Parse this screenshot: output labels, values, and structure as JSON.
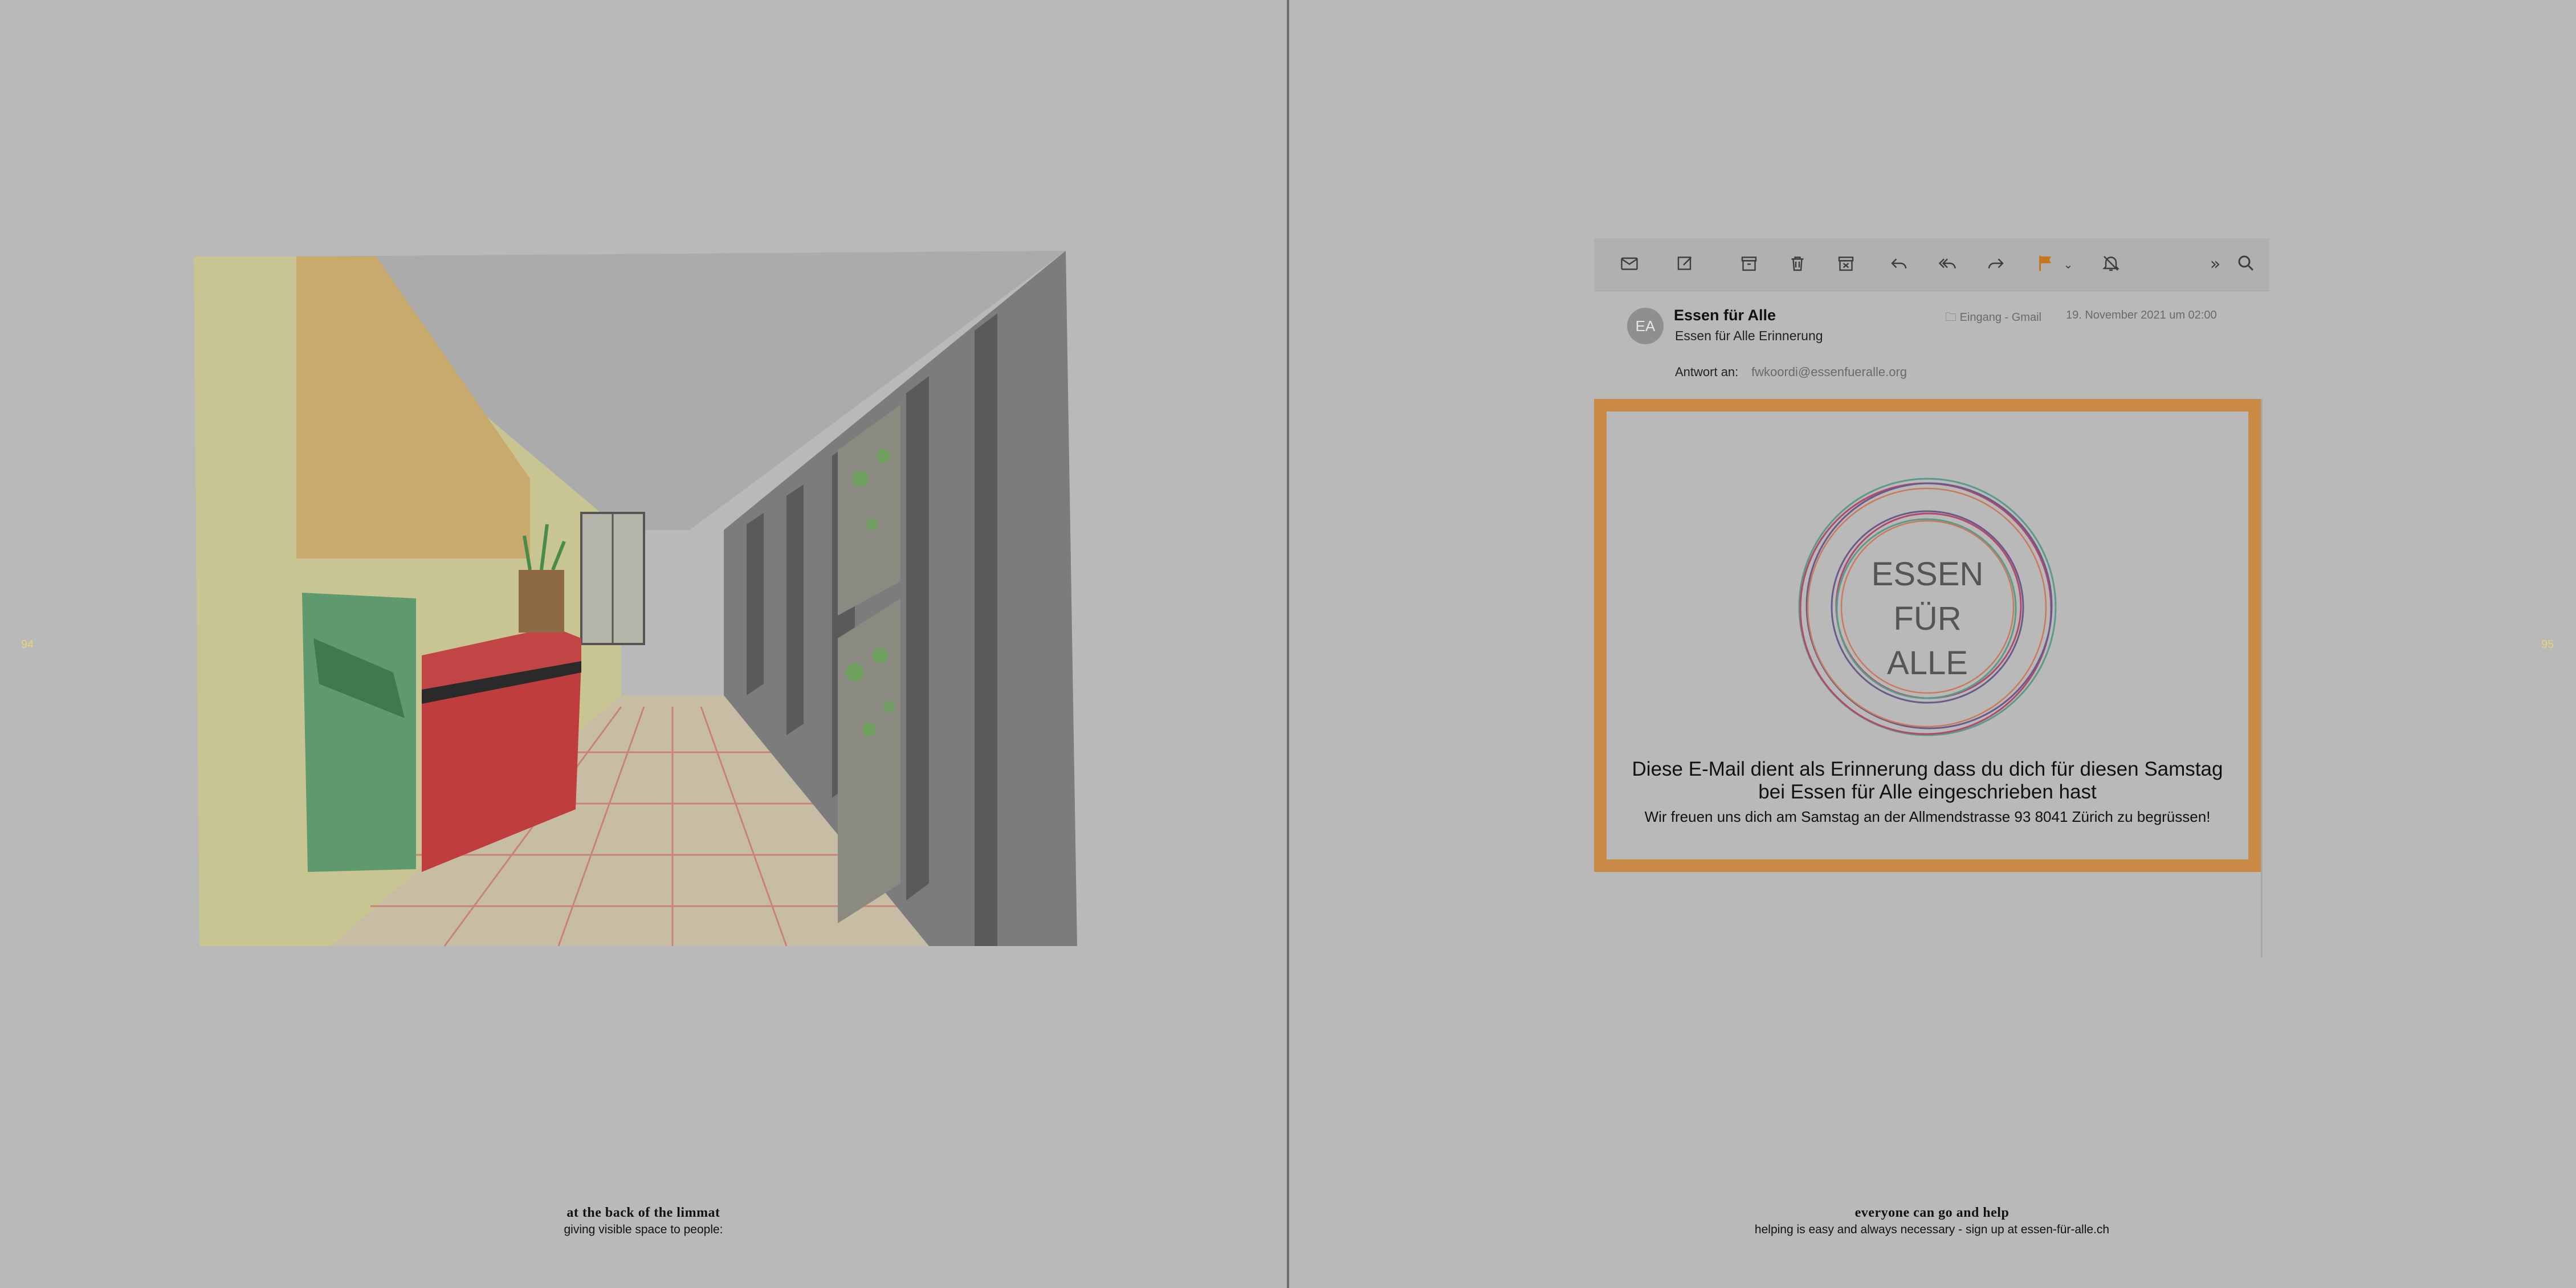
{
  "left_page": {
    "page_number": "94",
    "caption_title": "at the back of the limmat",
    "caption_sub": "giving visible space to people:"
  },
  "right_page": {
    "page_number": "95",
    "caption_title": "everyone can go and help",
    "caption_sub": "helping is easy and always necessary - sign up at essen-für-alle.ch"
  },
  "mail": {
    "toolbar_icons": [
      "envelope-icon",
      "compose-icon",
      "archive-icon",
      "trash-icon",
      "junk-icon",
      "reply-icon",
      "reply-all-icon",
      "forward-icon",
      "flag-icon",
      "chevron-down-icon",
      "mute-bell-icon",
      "more-icon",
      "search-icon"
    ],
    "flag_color": "#c8761e",
    "avatar_initials": "EA",
    "sender": "Essen für Alle",
    "subject": "Essen für Alle Erinnerung",
    "mailbox": "Eingang - Gmail",
    "date": "19. November 2021 um 02:00",
    "reply_to_label": "Antwort an:",
    "reply_to_address": "fwkoordi@essenfueralle.org",
    "card_border_color": "#c88a44",
    "logo_line1": "ESSEN",
    "logo_line2": "FÜR",
    "logo_line3": "ALLE",
    "message_line1": "Diese E-Mail dient als Erinnerung dass du dich für diesen Samstag",
    "message_line2": "bei Essen für Alle eingeschrieben hast",
    "message_line3": "Wir freuen uns dich am Samstag an der Allmendstrasse 93 8041 Zürich zu begrüssen!"
  }
}
